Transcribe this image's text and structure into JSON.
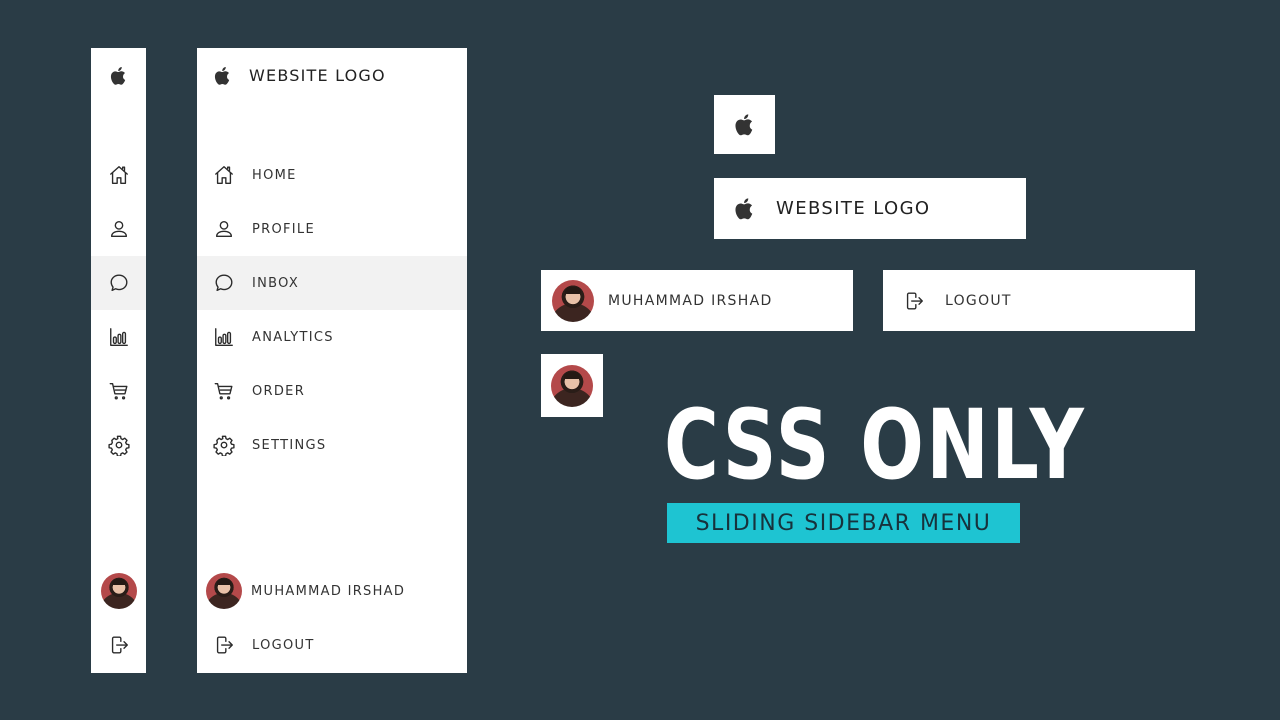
{
  "brand": {
    "logo_icon": "apple-icon",
    "logo_text": "WEBSITE LOGO"
  },
  "sidebar": {
    "items": [
      {
        "label": "HOME",
        "icon": "home-icon",
        "active": false
      },
      {
        "label": "PROFILE",
        "icon": "user-icon",
        "active": false
      },
      {
        "label": "INBOX",
        "icon": "chat-icon",
        "active": true
      },
      {
        "label": "ANALYTICS",
        "icon": "bar-chart-icon",
        "active": false
      },
      {
        "label": "ORDER",
        "icon": "cart-icon",
        "active": false
      },
      {
        "label": "SETTINGS",
        "icon": "gear-icon",
        "active": false
      }
    ],
    "user": {
      "name": "MUHAMMAD IRSHAD",
      "avatar": "avatar"
    },
    "logout": {
      "label": "LOGOUT",
      "icon": "logout-icon"
    }
  },
  "headline": {
    "title": "CSS ONLY",
    "subtitle": "SLIDING SIDEBAR MENU"
  },
  "colors": {
    "background": "#2a3c46",
    "panel": "#ffffff",
    "active_item": "#f2f2f2",
    "accent": "#1ec4d2",
    "text": "#333333"
  }
}
